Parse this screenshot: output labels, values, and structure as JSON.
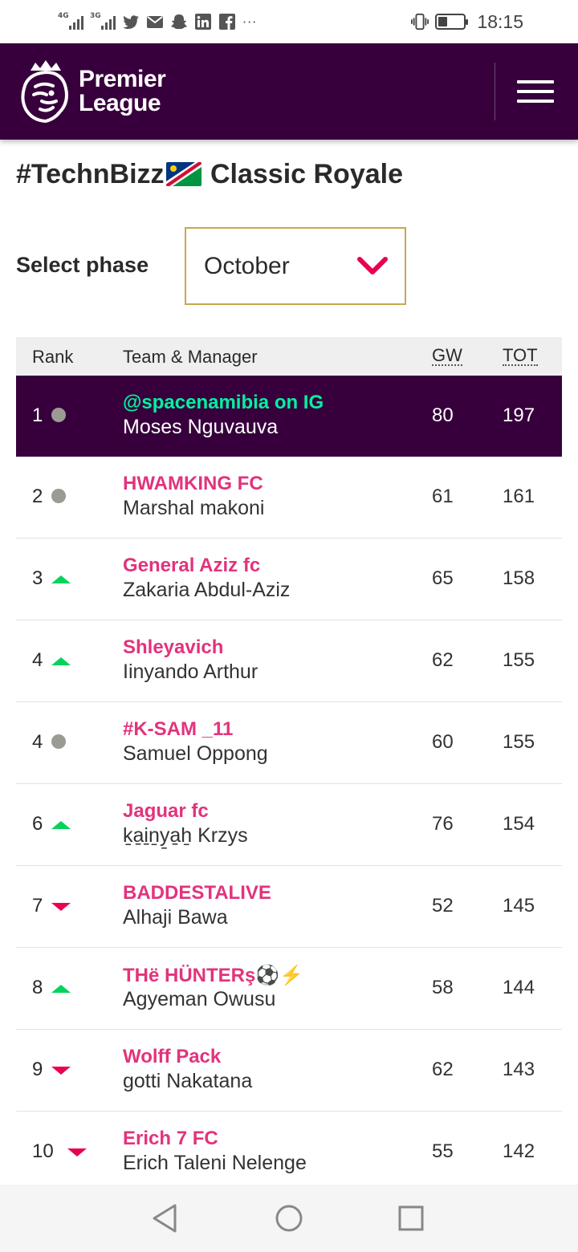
{
  "status_bar": {
    "network_1": "4G",
    "network_2": "3G",
    "more": "···",
    "time": "18:15",
    "battery_level": 0.35,
    "icons": [
      "signal-icon",
      "signal-icon",
      "twitter-icon",
      "mail-icon",
      "snapchat-icon",
      "linkedin-icon",
      "facebook-icon",
      "vibrate-icon",
      "battery-icon"
    ]
  },
  "header": {
    "logo_line1": "Premier",
    "logo_line2": "League",
    "accent": "#37003c"
  },
  "league": {
    "title_before": "#TechnBizz",
    "title_after": " Classic Royale"
  },
  "phase": {
    "label": "Select phase",
    "selected": "October"
  },
  "table": {
    "headers": {
      "rank": "Rank",
      "team": "Team & Manager",
      "gw": "GW",
      "tot": "TOT"
    },
    "rows": [
      {
        "rank": "1",
        "movement": "same",
        "team": "@spacenamibia on IG",
        "manager": "Moses Nguvauva",
        "gw": "80",
        "tot": "197"
      },
      {
        "rank": "2",
        "movement": "same",
        "team": "HWAMKING FC",
        "manager": "Marshal makoni",
        "gw": "61",
        "tot": "161"
      },
      {
        "rank": "3",
        "movement": "up",
        "team": "General Aziz fc",
        "manager": "Zakaria Abdul-Aziz",
        "gw": "65",
        "tot": "158"
      },
      {
        "rank": "4",
        "movement": "up",
        "team": "Shleyavich",
        "manager": "Iinyando Arthur",
        "gw": "62",
        "tot": "155"
      },
      {
        "rank": "4",
        "movement": "same",
        "team": "#K-SAM _11",
        "manager": "Samuel Oppong",
        "gw": "60",
        "tot": "155"
      },
      {
        "rank": "6",
        "movement": "up",
        "team": "Jaguar fc",
        "manager": "ḵa̱i̱ṉy̱a̱ẖ Krzys",
        "gw": "76",
        "tot": "154"
      },
      {
        "rank": "7",
        "movement": "down",
        "team": "BADDESTALIVE",
        "manager": "Alhaji Bawa",
        "gw": "52",
        "tot": "145"
      },
      {
        "rank": "8",
        "movement": "up",
        "team": "THë HÜNTERş⚽⚡",
        "manager": "Agyeman Owusu",
        "gw": "58",
        "tot": "144"
      },
      {
        "rank": "9",
        "movement": "down",
        "team": "Wolff Pack",
        "manager": "gotti Nakatana",
        "gw": "62",
        "tot": "143"
      },
      {
        "rank": "10",
        "movement": "down",
        "team": "Erich 7 FC",
        "manager": "Erich Taleni Nelenge",
        "gw": "55",
        "tot": "142"
      }
    ]
  },
  "nav_bar": {
    "icons": [
      "back-icon",
      "home-icon",
      "recents-icon"
    ]
  }
}
